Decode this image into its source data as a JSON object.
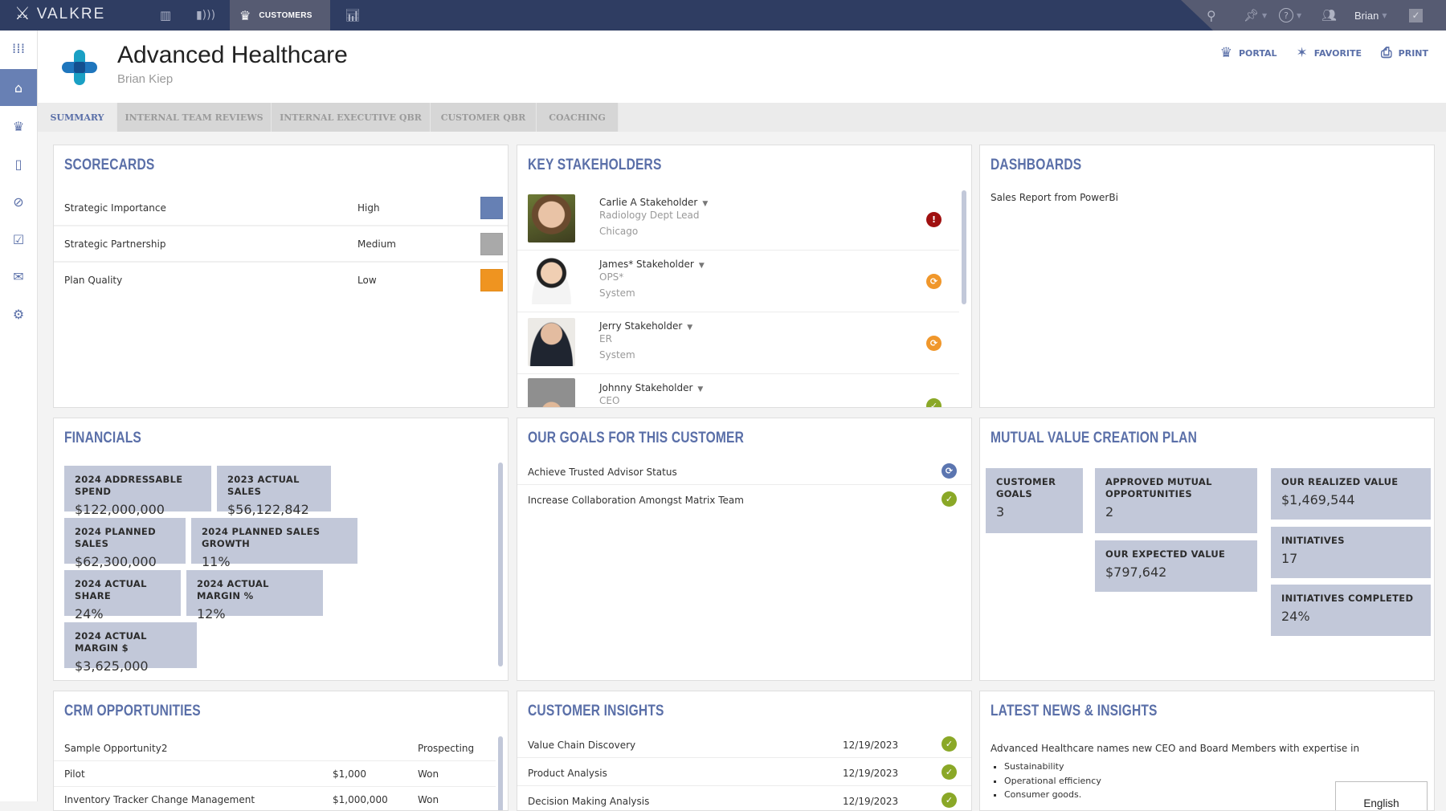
{
  "app": {
    "brand": "VALKRE",
    "nav": [
      {
        "icon": "dashboard-bars-icon"
      },
      {
        "icon": "signal-icon"
      },
      {
        "icon": "crown-icon",
        "label": "CUSTOMERS",
        "active": true
      },
      {
        "icon": "bar-chart-icon"
      }
    ],
    "user": "Brian",
    "toolbar_icons": [
      "search-icon",
      "pin-icon",
      "help-icon",
      "team-icon",
      "check-icon"
    ]
  },
  "sidebar": {
    "items": [
      {
        "icon": "apps-grid-icon"
      },
      {
        "icon": "home-icon",
        "active": true
      },
      {
        "icon": "customer-crown-icon"
      },
      {
        "icon": "door-icon"
      },
      {
        "icon": "compass-icon"
      },
      {
        "icon": "chart-check-icon"
      },
      {
        "icon": "report-icon"
      },
      {
        "icon": "gear-icon"
      }
    ]
  },
  "header": {
    "title": "Advanced Healthcare",
    "subtitle": "Brian Kiep",
    "actions": [
      {
        "label": "PORTAL",
        "icon": "portal-crown-icon"
      },
      {
        "label": "FAVORITE",
        "icon": "star-icon"
      },
      {
        "label": "PRINT",
        "icon": "printer-icon"
      }
    ]
  },
  "tabs": [
    {
      "label": "SUMMARY",
      "active": true
    },
    {
      "label": "INTERNAL TEAM REVIEWS"
    },
    {
      "label": "INTERNAL EXECUTIVE QBR"
    },
    {
      "label": "CUSTOMER QBR"
    },
    {
      "label": "COACHING"
    }
  ],
  "scorecards": {
    "title": "SCORECARDS",
    "rows": [
      {
        "name": "Strategic Importance",
        "value": "High",
        "color": "#6680b4"
      },
      {
        "name": "Strategic Partnership",
        "value": "Medium",
        "color": "#a9a9a9"
      },
      {
        "name": "Plan Quality",
        "value": "Low",
        "color": "#ef9420"
      }
    ]
  },
  "stakeholders": {
    "title": "KEY STAKEHOLDERS",
    "items": [
      {
        "name": "Carlie A Stakeholder",
        "role": "Radiology Dept Lead",
        "location": "Chicago",
        "status": "alert"
      },
      {
        "name": "James* Stakeholder",
        "role": "OPS*",
        "location": "System",
        "status": "in-progress"
      },
      {
        "name": "Jerry Stakeholder",
        "role": "ER",
        "location": "System",
        "status": "in-progress"
      },
      {
        "name": "Johnny Stakeholder",
        "role": "CEO",
        "location": "",
        "status": "complete"
      }
    ]
  },
  "dashboards": {
    "title": "DASHBOARDS",
    "items": [
      "Sales Report from PowerBi"
    ]
  },
  "financials": {
    "title": "FINANCIALS",
    "tiles": [
      {
        "label": "2024 ADDRESSABLE SPEND",
        "value": "$122,000,000"
      },
      {
        "label": "2023 ACTUAL SALES",
        "value": "$56,122,842"
      },
      {
        "label": "2024 PLANNED SALES",
        "value": "$62,300,000"
      },
      {
        "label": "2024 PLANNED SALES GROWTH",
        "value": "11%"
      },
      {
        "label": "2024 ACTUAL SHARE",
        "value": "24%"
      },
      {
        "label": "2024 ACTUAL MARGIN %",
        "value": "12%"
      },
      {
        "label": "2024 ACTUAL MARGIN $",
        "value": "$3,625,000"
      }
    ]
  },
  "goals": {
    "title": "OUR GOALS FOR THIS CUSTOMER",
    "items": [
      {
        "name": "Achieve Trusted Advisor Status",
        "status": "in-progress"
      },
      {
        "name": "Increase Collaboration Amongst Matrix Team",
        "status": "complete"
      }
    ]
  },
  "mvcp": {
    "title": "MUTUAL VALUE CREATION PLAN",
    "tiles": [
      {
        "label": "CUSTOMER GOALS",
        "value": "3"
      },
      {
        "label": "APPROVED MUTUAL OPPORTUNITIES",
        "value": "2"
      },
      {
        "label": "OUR EXPECTED VALUE",
        "value": "$797,642"
      },
      {
        "label": "OUR REALIZED VALUE",
        "value": "$1,469,544"
      },
      {
        "label": "INITIATIVES",
        "value": "17"
      },
      {
        "label": "INITIATIVES COMPLETED",
        "value": "24%"
      }
    ]
  },
  "crm": {
    "title": "CRM OPPORTUNITIES",
    "rows": [
      {
        "name": "Sample Opportunity2",
        "amount": "",
        "stage": "Prospecting"
      },
      {
        "name": "Pilot",
        "amount": "$1,000",
        "stage": "Won"
      },
      {
        "name": "Inventory Tracker Change Management",
        "amount": "$1,000,000",
        "stage": "Won"
      }
    ]
  },
  "insights": {
    "title": "CUSTOMER INSIGHTS",
    "rows": [
      {
        "name": "Value Chain Discovery",
        "date": "12/19/2023",
        "status": "complete"
      },
      {
        "name": "Product Analysis",
        "date": "12/19/2023",
        "status": "complete"
      },
      {
        "name": "Decision Making Analysis",
        "date": "12/19/2023",
        "status": "complete"
      }
    ]
  },
  "news": {
    "title": "LATEST NEWS & INSIGHTS",
    "headline": "Advanced Healthcare names new CEO and Board Members with expertise in",
    "bullets": [
      "Sustainability",
      "Operational efficiency",
      "Consumer goods."
    ],
    "language": "English"
  }
}
